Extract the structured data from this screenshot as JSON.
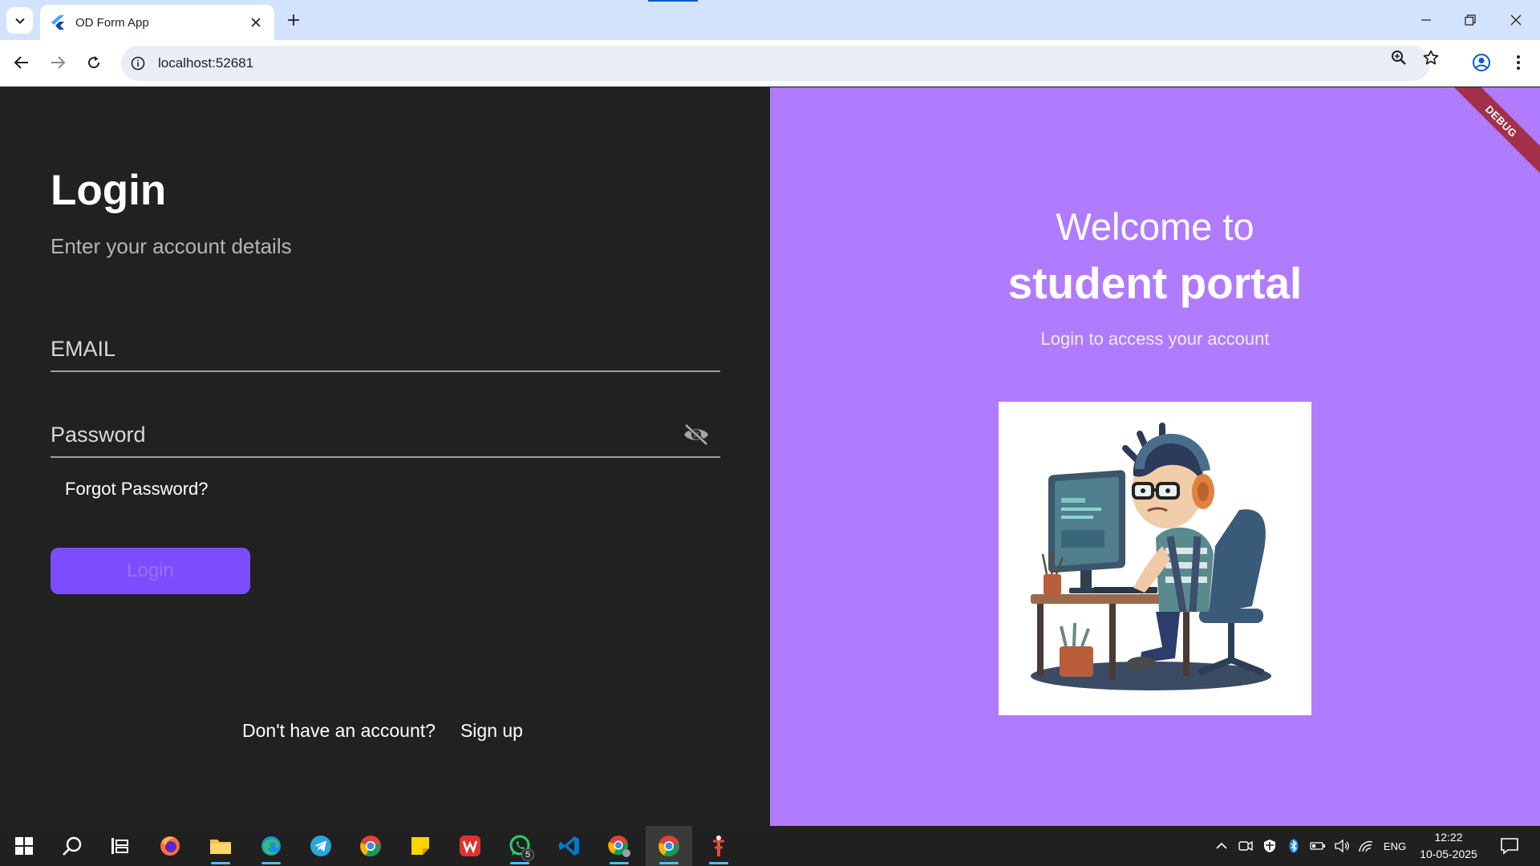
{
  "browser": {
    "tab_title": "OD Form App",
    "url": "localhost:52681"
  },
  "login": {
    "title": "Login",
    "subtitle": "Enter your account details",
    "email_placeholder": "EMAIL",
    "email_value": "",
    "password_placeholder": "Password",
    "password_value": "",
    "forgot_label": "Forgot Password?",
    "button_label": "Login",
    "no_account_text": "Don't have an account?",
    "signup_label": "Sign up"
  },
  "welcome": {
    "line1": "Welcome to",
    "line2": "student portal",
    "tagline": "Login to access your account"
  },
  "debug_banner": "DEBUG",
  "taskbar": {
    "apps": [
      "start",
      "search",
      "task-view",
      "firefox",
      "file-explorer",
      "edge",
      "telegram",
      "chrome",
      "sticky-notes",
      "wps-office",
      "whatsapp",
      "vscode",
      "chrome-profile",
      "chrome-active",
      "git-gui"
    ],
    "whatsapp_badge": "5",
    "language": "ENG",
    "time": "12:22",
    "date": "10-05-2025"
  },
  "colors": {
    "left_panel_bg": "#212121",
    "right_panel_bg": "#b07bff",
    "login_button_bg": "#7c4dff",
    "debug_ribbon": "#a2304a"
  }
}
